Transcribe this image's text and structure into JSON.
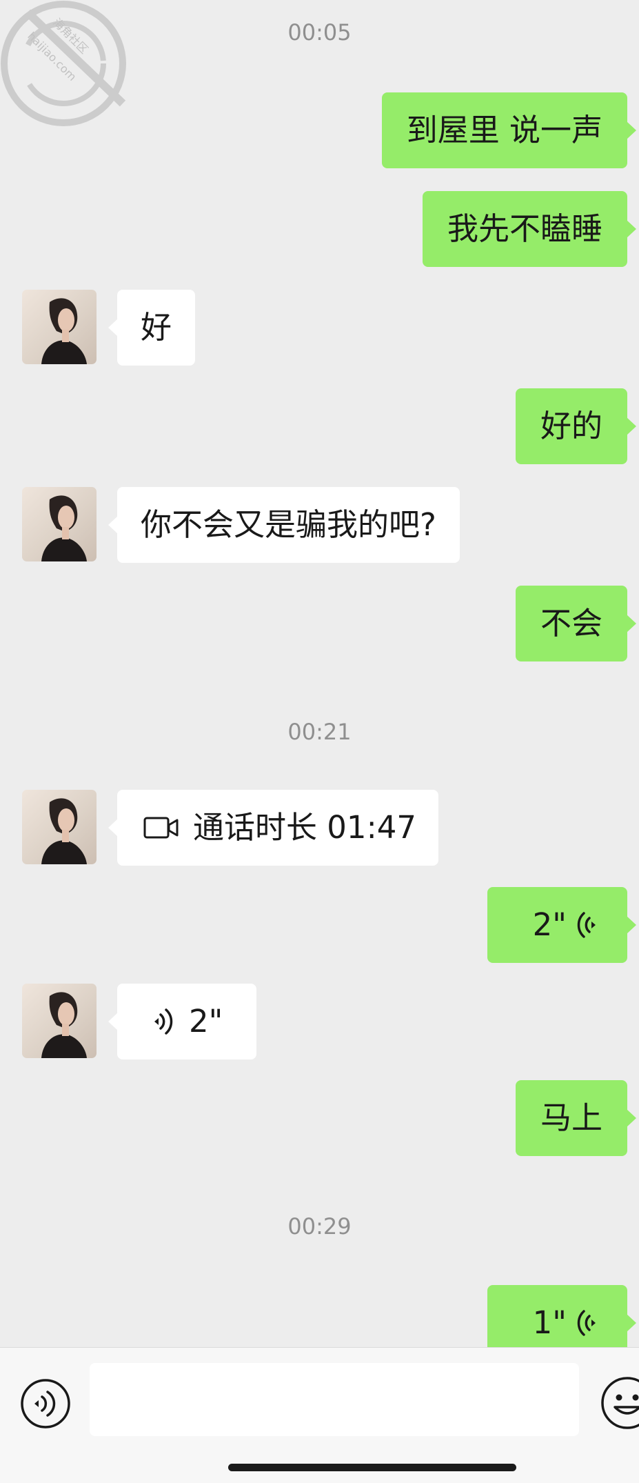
{
  "watermark": {
    "text": "haijiao.com",
    "text_cn": "海角社区"
  },
  "timestamps": [
    "00:05",
    "00:21",
    "00:29"
  ],
  "messages": [
    {
      "side": "out",
      "type": "text",
      "text": "到屋里 说一声"
    },
    {
      "side": "out",
      "type": "text",
      "text": "我先不瞌睡"
    },
    {
      "side": "in",
      "type": "text",
      "text": "好"
    },
    {
      "side": "out",
      "type": "text",
      "text": "好的"
    },
    {
      "side": "in",
      "type": "text",
      "text": "你不会又是骗我的吧?"
    },
    {
      "side": "out",
      "type": "text",
      "text": "不会"
    },
    {
      "side": "in",
      "type": "video-call",
      "text": "通话时长 01:47",
      "icon": "video-camera-icon"
    },
    {
      "side": "out",
      "type": "voice",
      "duration": "2\"",
      "icon": "voice-wave-icon"
    },
    {
      "side": "in",
      "type": "voice",
      "duration": "2\"",
      "icon": "voice-wave-icon"
    },
    {
      "side": "out",
      "type": "text",
      "text": "马上"
    },
    {
      "side": "out",
      "type": "voice",
      "duration": "1\"",
      "icon": "voice-wave-icon"
    }
  ],
  "input": {
    "placeholder": "",
    "value": ""
  },
  "colors": {
    "background": "#ededed",
    "out_bubble": "#95ec69",
    "in_bubble": "#ffffff",
    "timestamp": "#8f8f8f"
  }
}
